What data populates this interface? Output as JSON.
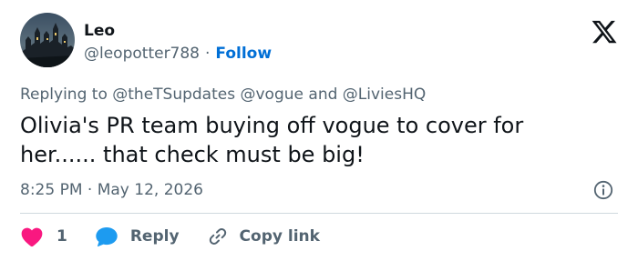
{
  "author": {
    "display_name": "Leo",
    "handle": "@leopotter788",
    "separator": "·",
    "follow_label": "Follow",
    "avatar_icon": "castle-night-avatar"
  },
  "brand": {
    "logo_icon": "x-logo-icon"
  },
  "reply_context": {
    "prefix": "Replying to",
    "mentions": [
      "@theTSupdates",
      "@vogue",
      "@LiviesHQ"
    ],
    "conjunction": "and"
  },
  "tweet": {
    "text_line1": "Olivia's PR team buying off vogue to cover for",
    "text_line2": "her...... that check must be big!",
    "time": "8:25 PM",
    "date_separator": "·",
    "date": "May 12, 2026"
  },
  "actions": {
    "like_count": "1",
    "reply_label": "Reply",
    "copy_label": "Copy link"
  },
  "colors": {
    "text_primary": "#0f1419",
    "text_secondary": "#536471",
    "link_blue": "#006fd6",
    "like_red": "#f91880",
    "reply_blue": "#1d9bf0",
    "divider": "#cfd9de"
  }
}
